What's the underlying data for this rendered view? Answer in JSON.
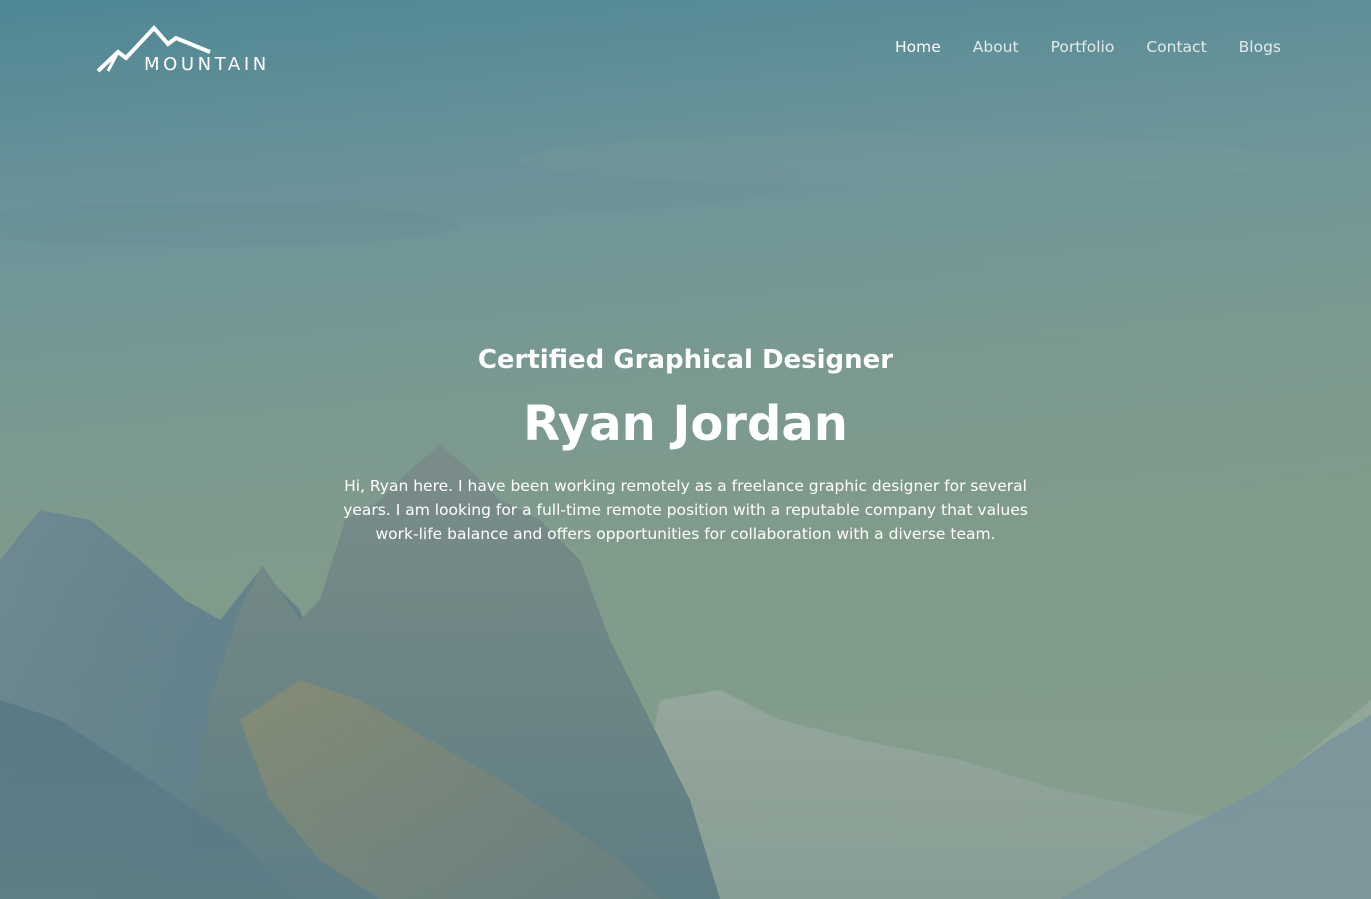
{
  "logo": {
    "text": "MOUNTAIN",
    "icon": "mountain-logo-icon"
  },
  "nav": {
    "items": [
      {
        "label": "Home",
        "active": true
      },
      {
        "label": "About",
        "active": false
      },
      {
        "label": "Portfolio",
        "active": false
      },
      {
        "label": "Contact",
        "active": false
      },
      {
        "label": "Blogs",
        "active": false
      }
    ]
  },
  "hero": {
    "subtitle": "Certified Graphical Designer",
    "title": "Ryan Jordan",
    "text": "Hi, Ryan here. I have been working remotely as a freelance graphic designer for several years. I am looking for a full-time remote position with a reputable company that values work-life balance and offers opportunities for collaboration with a diverse team."
  },
  "colors": {
    "text": "#ffffff",
    "sky_top": "#4f8795",
    "sky_bottom": "#8aa08a",
    "mountain": "#5d7f89"
  }
}
